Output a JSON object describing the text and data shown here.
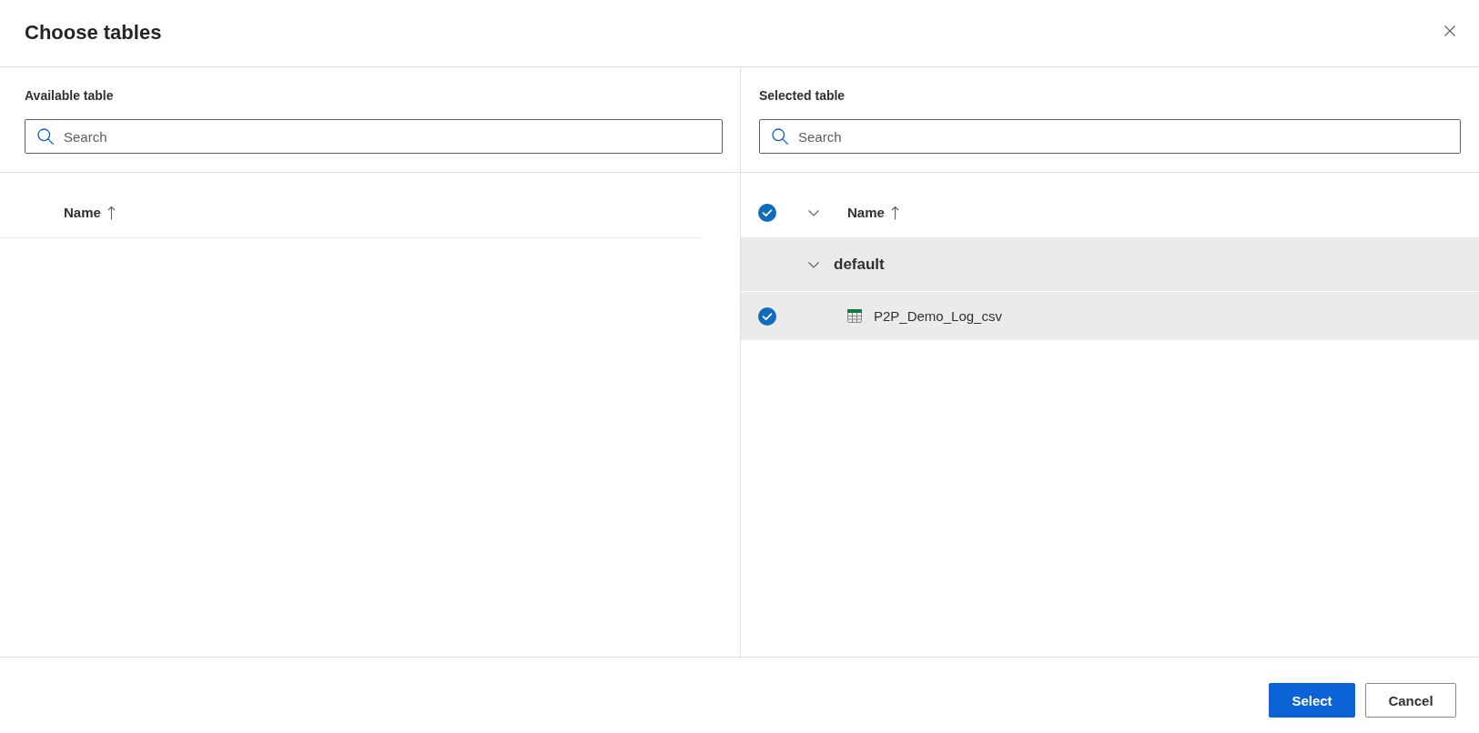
{
  "dialog": {
    "title": "Choose tables"
  },
  "available_panel": {
    "label": "Available table",
    "search": {
      "placeholder": "Search"
    },
    "table": {
      "columns": [
        {
          "label": "Name",
          "sort_ascending": true
        }
      ]
    }
  },
  "selected_panel": {
    "label": "Selected table",
    "search": {
      "placeholder": "Search"
    },
    "table": {
      "select_all": {
        "checked": true
      },
      "groups_expanded": true,
      "columns": [
        {
          "label": "Name",
          "sort_ascending": true
        }
      ],
      "groups": [
        {
          "name": "default",
          "expanded": true,
          "selected": true,
          "children": [
            {
              "name": "P2P_Demo_Log_csv",
              "checked": true,
              "selected": true
            }
          ]
        }
      ]
    }
  },
  "buttons": [
    {
      "label": "Select",
      "kind": "primary"
    },
    {
      "label": "Cancel",
      "kind": "secondary"
    }
  ]
}
